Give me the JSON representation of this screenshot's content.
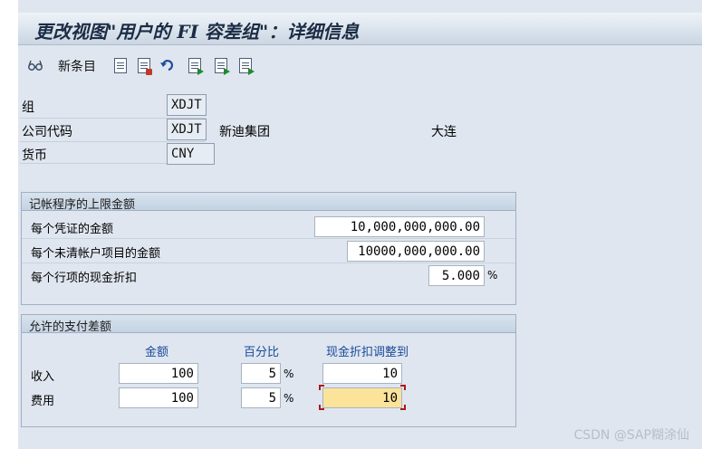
{
  "window": {
    "title": "更改视图\"用户的 FI 容差组\"：详细信息"
  },
  "toolbar": {
    "new_entries_label": "新条目",
    "icons": [
      "glasses-icon",
      "copy-icon",
      "delete-icon",
      "undo-icon",
      "previous-entry-icon",
      "next-entry-icon",
      "select-entry-icon"
    ]
  },
  "header": {
    "group_label": "组",
    "group_value": "XDJT",
    "company_label": "公司代码",
    "company_value": "XDJT",
    "company_name": "新迪集团",
    "company_city": "大连",
    "currency_label": "货币",
    "currency_value": "CNY"
  },
  "posting_limits": {
    "title": "记帐程序的上限金额",
    "rows": [
      {
        "label": "每个凭证的金额",
        "value": "10,000,000,000.00"
      },
      {
        "label": "每个未清帐户项目的金额",
        "value": "10000,000,000.00"
      },
      {
        "label": "每个行项的现金折扣",
        "value": "5.000",
        "unit": "%"
      }
    ]
  },
  "payment_differences": {
    "title": "允许的支付差额",
    "columns": [
      "金额",
      "百分比",
      "现金折扣调整到"
    ],
    "rows": [
      {
        "label": "收入",
        "amount": "100",
        "percent": "5",
        "discount_adjust": "10"
      },
      {
        "label": "费用",
        "amount": "100",
        "percent": "5",
        "discount_adjust": "10"
      }
    ],
    "percent_unit": "%"
  },
  "watermark": "CSDN @SAP糊涂仙",
  "colors": {
    "background": "#dfe6ef",
    "column_header": "#1a4a9a",
    "focused_field": "#fbe39a"
  }
}
